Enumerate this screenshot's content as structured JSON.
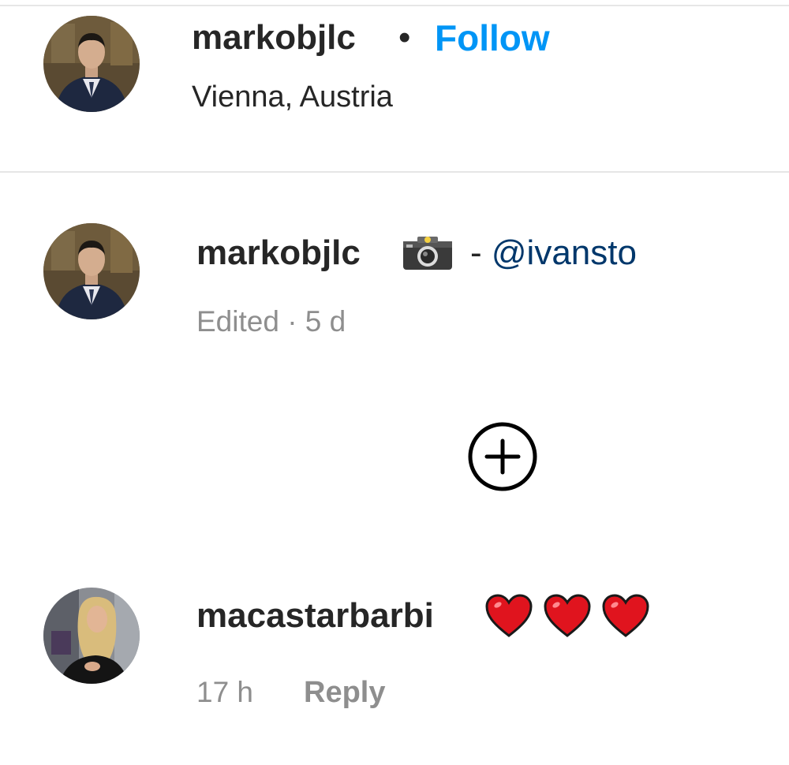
{
  "post_header": {
    "username": "markobjlc",
    "separator": "•",
    "follow_label": "Follow",
    "location": "Vienna, Austria",
    "avatar_icon": "profile-avatar-man-in-suit"
  },
  "caption": {
    "username": "markobjlc",
    "emoji_icon": "camera-with-flash-icon",
    "text_prefix": " - ",
    "mention": "@ivansto",
    "meta": "Edited · 5 d"
  },
  "load_more": {
    "icon": "plus-circle-icon"
  },
  "comments": [
    {
      "username": "macastarbarbi",
      "emoji_icon": "red-heart-icon",
      "emoji_count": 3,
      "time": "17 h",
      "reply_label": "Reply"
    }
  ],
  "colors": {
    "primary_text": "#262626",
    "secondary_text": "#8e8e8e",
    "follow_blue": "#0095f6",
    "mention_blue": "#00376b",
    "divider": "#e6e6e6",
    "heart_red": "#e0141e"
  }
}
